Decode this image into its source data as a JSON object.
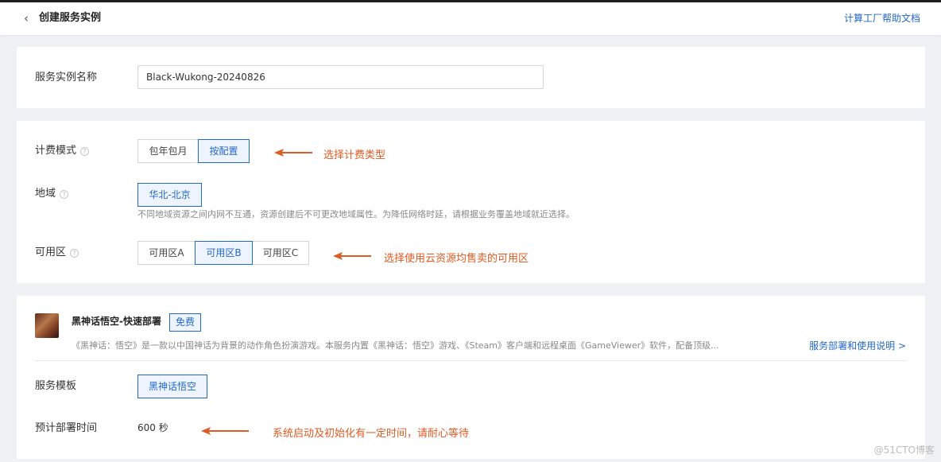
{
  "header": {
    "back_icon": "chevron-left-icon",
    "title": "创建服务实例",
    "help_link": "计算工厂帮助文档"
  },
  "instance_name": {
    "label": "服务实例名称",
    "value": "Black-Wukong-20240826"
  },
  "billing": {
    "label": "计费模式",
    "options": [
      "包年包月",
      "按配置"
    ],
    "selected": "按配置",
    "annotation": "选择计费类型"
  },
  "region": {
    "label": "地域",
    "selected": "华北-北京",
    "hint": "不同地域资源之间内网不互通，资源创建后不可更改地域属性。为降低网络时延，请根据业务覆盖地域就近选择。"
  },
  "zone": {
    "label": "可用区",
    "options": [
      "可用区A",
      "可用区B",
      "可用区C"
    ],
    "selected": "可用区B",
    "annotation": "选择使用云资源均售卖的可用区"
  },
  "product": {
    "name": "黑神话悟空-快速部署",
    "badge": "免费",
    "description": "《黑神话：悟空》是一款以中国神话为背景的动作角色扮演游戏。本服务内置《黑神话：悟空》游戏、《Steam》客户端和远程桌面《GameViewer》软件，配备顶级...",
    "doc_link": "服务部署和使用说明 >"
  },
  "template": {
    "label": "服务模板",
    "selected": "黑神话悟空"
  },
  "deploy_time": {
    "label": "预计部署时间",
    "value": "600 秒",
    "annotation": "系统启动及初始化有一定时间，请耐心等待"
  },
  "watermark": "@51CTO博客",
  "colors": {
    "accent": "#2468c8",
    "annotation": "#e05a22",
    "background": "#f0f1f4"
  }
}
